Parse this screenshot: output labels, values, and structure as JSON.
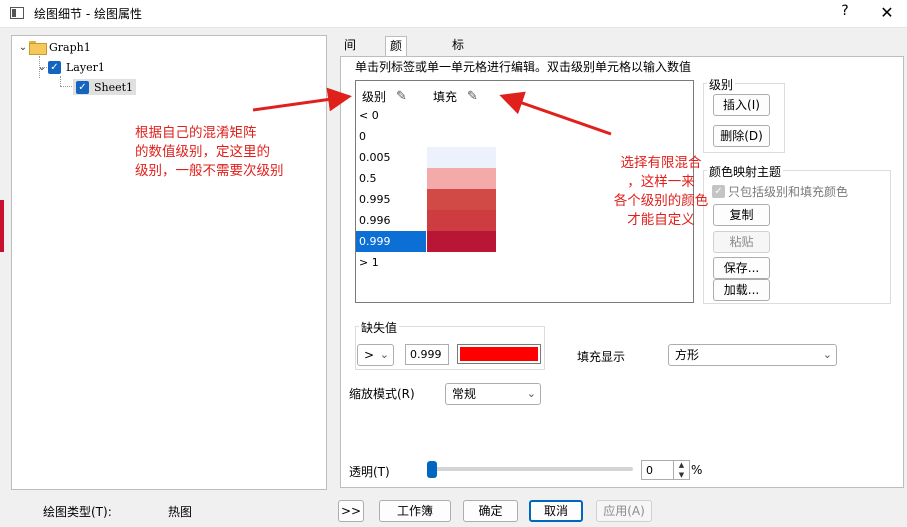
{
  "window": {
    "title": "绘图细节 - 绘图属性",
    "help_label": "?",
    "close_label": "✕"
  },
  "tree": {
    "graph": "Graph1",
    "layer": "Layer1",
    "sheet": "Sheet1"
  },
  "tabs": [
    "间距",
    "颜色映射",
    "标签"
  ],
  "instruction": "单击列标签或单一单元格进行编辑。双击级别单元格以输入数值",
  "grid": {
    "col_level": "级别",
    "col_fill": "填充",
    "rows": [
      {
        "level": "< 0",
        "color": ""
      },
      {
        "level": "0",
        "color": ""
      },
      {
        "level": "0.005",
        "color": "#ecf1fb"
      },
      {
        "level": "0.5",
        "color": "#f5aaaa"
      },
      {
        "level": "0.995",
        "color": "#d24a45"
      },
      {
        "level": "0.996",
        "color": "#cc3c40"
      },
      {
        "level": "0.999",
        "color": "#b81634"
      },
      {
        "level": "> 1",
        "color": ""
      }
    ],
    "selected_level": "0.999"
  },
  "level_group": {
    "title": "级别",
    "insert": "插入(I)",
    "delete": "删除(D)"
  },
  "theme_group": {
    "title": "颜色映射主题",
    "only_include": "只包括级别和填充颜色",
    "copy": "复制",
    "paste": "粘贴",
    "save": "保存...",
    "load": "加载..."
  },
  "missing": {
    "title": "缺失值",
    "op": ">",
    "value": "0.999",
    "color": "#ff0000"
  },
  "fill_display": {
    "label": "填充显示",
    "value": "方形"
  },
  "scale_mode": {
    "label": "缩放模式(R)",
    "value": "常规"
  },
  "transparency": {
    "label": "透明(T)",
    "value": "0",
    "unit": "%",
    "level_percent": 0
  },
  "footer": {
    "plot_type_label": "绘图类型(T):",
    "plot_type_value": "热图",
    "expand": ">>",
    "workbook": "工作簿",
    "ok": "确定",
    "cancel": "取消",
    "apply": "应用(A)"
  },
  "annotations": {
    "left": [
      "根据自己的混淆矩阵",
      "的数值级别，定这里的",
      "级别，一般不需要次级别"
    ],
    "right": [
      "选择有限混合",
      "，这样一来",
      "各个级别的颜色",
      "才能自定义"
    ],
    "color": "#e0201c"
  },
  "colors": {
    "accent": "#0067c0",
    "selection": "#0b6fd6"
  }
}
